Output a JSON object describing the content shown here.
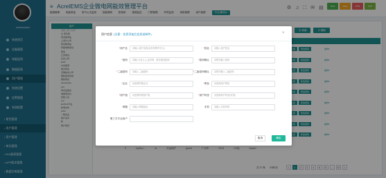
{
  "app": {
    "title": "AcrelEMS企业微电网能效管理平台",
    "user_name": "administrator",
    "menu_icon": "menu-icon",
    "tool_icons": "⚙ ♫ ⛶ ✉ ▤ ⏻",
    "language_dropdown": "中文(简体)▾"
  },
  "top_nav": [
    "能源管理",
    "电能质量",
    "电气火灾监测",
    "智能照明",
    "配电房",
    "视频监控",
    "门禁管理",
    "环境监测",
    "消防管理",
    "用户管理"
  ],
  "brand_badges": [
    {
      "label": "SAS",
      "color": "#4caf50"
    },
    {
      "label": "SCS",
      "color": "#f5a623"
    },
    {
      "label": "SYS",
      "color": "#e65c5c"
    },
    {
      "label": "ACT",
      "color": "#7cb342"
    }
  ],
  "sidebar": {
    "items": [
      {
        "label": "系统首页"
      },
      {
        "label": "设备管理"
      },
      {
        "label": "电能监测"
      },
      {
        "label": "数据报表"
      },
      {
        "label": "用户管理",
        "active": true
      },
      {
        "label": "系统设置"
      },
      {
        "label": "告警管理"
      },
      {
        "label": "系统配置"
      },
      {
        "label": "• 角色管理"
      },
      {
        "label": "• 用户管理",
        "active": true
      },
      {
        "label": "• 用户管理"
      },
      {
        "label": "• 单位管理"
      },
      {
        "label": "• RIS报表管理"
      },
      {
        "label": "• APP版本管理"
      },
      {
        "label": "• 数据字典管理"
      }
    ]
  },
  "main": {
    "tree_title": "用户",
    "tree_search": "请输入部门名称",
    "tree_nodes": [
      "▣ 安科瑞",
      "测试能源站",
      "上海分公司",
      "测试能源站",
      "智能电网测试",
      "测试",
      "江苏测试",
      "仪表公司",
      "EMS",
      "仪表能源",
      "电力机房",
      "无锡技术公司",
      "能耗监测系统",
      "能耗测试",
      "panelpfpdg",
      "test",
      "测试设备总",
      "电量测试仪",
      "安装人员",
      "test",
      "EMSSX平台",
      "新测试中",
      "2222",
      "一级企业",
      "客户演示",
      "新",
      "客户测试"
    ],
    "buttons": [
      "⊕ 新增",
      "⊖ 删除"
    ],
    "row_ops": [
      [
        "启用设置",
        "修改密码",
        "操作▾"
      ],
      [
        "启用设置",
        "修改密码",
        "操作▾"
      ],
      [
        "启用设置",
        "修改密码",
        "操作▾"
      ],
      [
        "启用设置",
        "修改密码",
        "操作▾"
      ],
      [
        "启用设置",
        "修改密码",
        "操作▾"
      ],
      [
        "启用设置",
        "修改密码",
        "操作▾"
      ],
      [
        "启用设置",
        "修改密码",
        "操作▾"
      ],
      [
        "启用设置",
        "修改密码",
        "操作▾"
      ],
      [
        "启用设置",
        "修改密码",
        "操作▾"
      ]
    ],
    "bottom_row": [
      "3",
      "myDev...",
      "ai",
      "平台用户",
      "guest",
      "广州市",
      "0213",
      "CS品",
      "mydev"
    ],
    "pager": {
      "total": "共 22 条",
      "page_size": "20条/页",
      "pages": [
        "<",
        "1",
        "2",
        "3",
        "4",
        "5",
        "6",
        "...",
        "10",
        ">"
      ],
      "current": "1"
    }
  },
  "dialog": {
    "title": "用户信息",
    "hint": "(注意：信息添加后会发送邮件)",
    "close_icon": "×",
    "fields": [
      {
        "label": "用户名",
        "required": true,
        "placeholder": "请输入用户名称(手机号等不可以)"
      },
      {
        "label": "姓名",
        "required": true,
        "placeholder": "请输入用户姓名"
      },
      {
        "label": "密码",
        "required": true,
        "placeholder": "请输入6位以上,由字母、数字组成密码"
      },
      {
        "label": "密码确认",
        "required": true,
        "placeholder": "请再次输入密码"
      },
      {
        "label": "二级密码",
        "required": true,
        "placeholder": "请输入二级密码"
      },
      {
        "label": "二级密码确认",
        "required": true,
        "placeholder": "请再次输入二级密码"
      },
      {
        "label": "企业",
        "required": true,
        "placeholder": "请选择所属企业"
      },
      {
        "label": "角色",
        "required": true,
        "placeholder": "请选择用户角色"
      },
      {
        "label": "用户组",
        "required": true,
        "placeholder": "请选择所属用户组"
      },
      {
        "label": "用户状态",
        "required": true,
        "placeholder": "请选择用户状态(可用)"
      },
      {
        "label": "邮箱",
        "required": false,
        "placeholder": "请输入邮箱地址"
      },
      {
        "label": "手机",
        "required": false,
        "placeholder": "请输入手机号码"
      },
      {
        "label": "第三方平台用户",
        "required": false,
        "placeholder": ""
      }
    ],
    "cancel_label": "取消",
    "ok_label": "确定"
  }
}
